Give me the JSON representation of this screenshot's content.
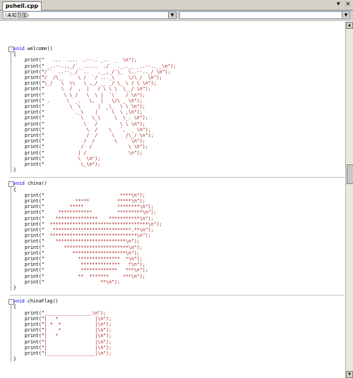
{
  "tab": {
    "label": "pshell.cpp"
  },
  "window_controls": {
    "dropdown": "▾",
    "close": "×"
  },
  "combos": {
    "left": "(未知范围)",
    "right": ""
  },
  "functions": [
    {
      "kind": "void",
      "name": "welcome()"
    },
    {
      "kind": "void",
      "name": "china()"
    },
    {
      "kind": "void",
      "name": "chinaFlag()"
    }
  ],
  "welcome_lines": [
    "   ...  .... ..--.. _..  _  \\n\");",
    " _..--..,_/`_ .....  ./`  ._..__ _..--..__\\n\");",
    "/``  ..--._/ `..   .__,_/`\\_  \\..--.._/ \\n\");",
    "/  /\\__  `  \\ /  `/ ..._\\ `   \\/\\_/  \\n\");",
    "\\_/   \\  \\\\   \\ ,_/ __ _/ \\_ \\ / \\ \\n\");",
    "      \\  /  ,  |   / \\ \\ \\  \\__/ \\n\");",
    "       \\ \\ /   \\  \\ |  `\\`   / \\n\");",
    " .      \\ `_.   \\,  |   \\/\\ _ \\n\");",
    "         \\  \\      |  _\\_  \\ \\ \\n\");",
    "          `._\\    |   ` \\  \\ ,\\n\");",
    "             \\   \\_\\     \\  \\_. \\n\");",
    "              \\   /        \\ \\ \\n\");",
    "               \\  /    \\   `,  _ \\n\");",
    "               /  /     \\    /\\_/ \\n\");",
    "              /  /       \\   ` \\n\");",
    "             /  /             \\ \\n\");",
    "            | /               \\n\");",
    "            \\  \\n\");",
    "             \\_\\n\");"
  ],
  "china_lines": [
    "                           ****\\n\");",
    "           *****          *****\\n\");",
    "         *****            ********\\n\");",
    "     ************         *********\\n\");",
    "    ***************    ***********\\n\");",
    "  ***********************************\\n\");",
    "   ****************************.**\\n\");",
    "  *******************************\\n\");",
    "    *************************\\n\");",
    "       ***********************\\n\");",
    "          *******************\\n\");",
    "            ***************  *\\n\");",
    "             **************   *\\n\");",
    "             *************   ***\\n\");",
    "            **  *******     ***\\n\");",
    "                    **\\n\");"
  ],
  "flag_lines": [
    "_________________\\n\");",
    "|   *             |\\n\");",
    "| *  *            |\\n\");",
    "|    *            |\\n\");",
    "|   *             |\\n\");",
    "|                 |\\n\");",
    "|                 |\\n\");",
    "|_________________|\\n\");"
  ],
  "keywords": {
    "print": "print(\"",
    "brace_open": "{",
    "brace_close": "}"
  },
  "colors": {
    "keyword": "#0000ff",
    "string": "#a31515",
    "chrome": "#d4d0c8"
  }
}
